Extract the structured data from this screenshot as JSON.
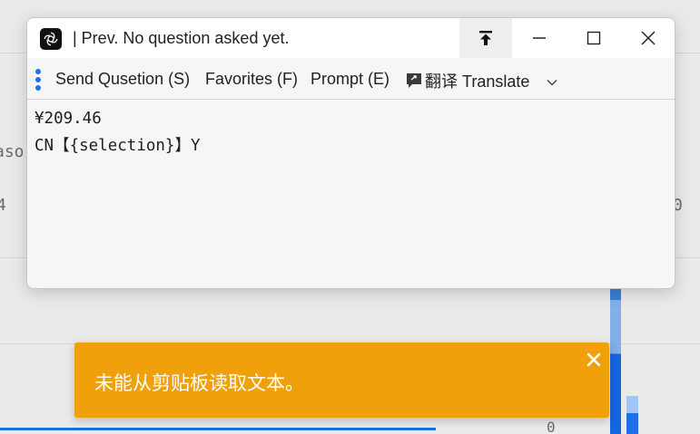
{
  "background_app": {
    "left_fragment": "aso",
    "left_number": "4",
    "right_number": "0",
    "bottom_zero": "0"
  },
  "window": {
    "title": "| Prev. No question asked yet.",
    "controls": {
      "pin": "pin-to-top-icon",
      "minimize": "minimize-icon",
      "maximize": "maximize-icon",
      "close": "close-icon"
    }
  },
  "toolbar": {
    "send": "Send Qusetion (S)",
    "favorites": "Favorites (F)",
    "prompt": "Prompt (E)",
    "translate": "翻译 Translate"
  },
  "content": {
    "line1": "¥209.46",
    "line2": "CN【{selection}】Y"
  },
  "toast": {
    "message": "未能从剪贴板读取文本。",
    "color": "#f0a00a"
  },
  "colors": {
    "accent": "#1a73e8"
  }
}
